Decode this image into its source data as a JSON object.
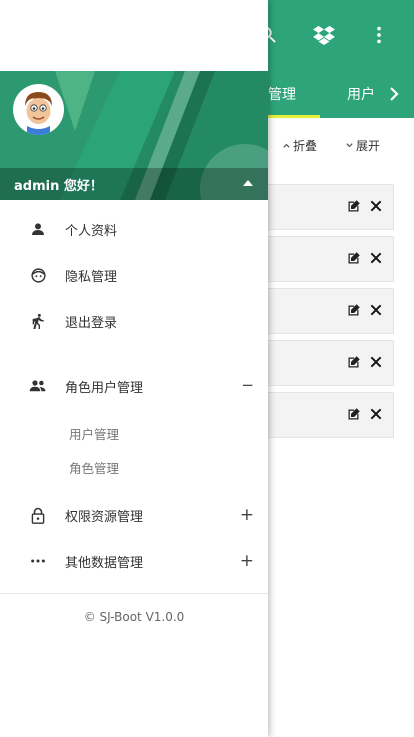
{
  "appbar": {
    "back_icon": "arrow-left-icon",
    "search_icon": "search-icon",
    "dropbox_icon": "dropbox-icon",
    "more_icon": "more-vertical-icon",
    "color": "#2da47a"
  },
  "tabs": {
    "items": [
      "管理",
      "用户"
    ],
    "active_index": 0,
    "next_icon": "chevron-right-icon",
    "indicator_color": "#e6ef3a"
  },
  "toolbar": {
    "collapse_label": "折叠",
    "expand_label": "展开"
  },
  "rows": {
    "count": 5,
    "edit_icon": "edit-icon",
    "delete_icon": "close-icon"
  },
  "drawer": {
    "greeting": "admin 您好！",
    "menu": [
      {
        "label": "个人资料",
        "icon": "user-icon"
      },
      {
        "label": "隐私管理",
        "icon": "face-icon"
      },
      {
        "label": "退出登录",
        "icon": "run-icon"
      },
      {
        "label": "角色用户管理",
        "icon": "group-icon",
        "toggle": "−",
        "expanded": true,
        "children": [
          "用户管理",
          "角色管理"
        ]
      },
      {
        "label": "权限资源管理",
        "icon": "lock-icon",
        "toggle": "+"
      },
      {
        "label": "其他数据管理",
        "icon": "more-horizontal-icon",
        "toggle": "+"
      }
    ],
    "footer": "© SJ-Boot V1.0.0"
  }
}
